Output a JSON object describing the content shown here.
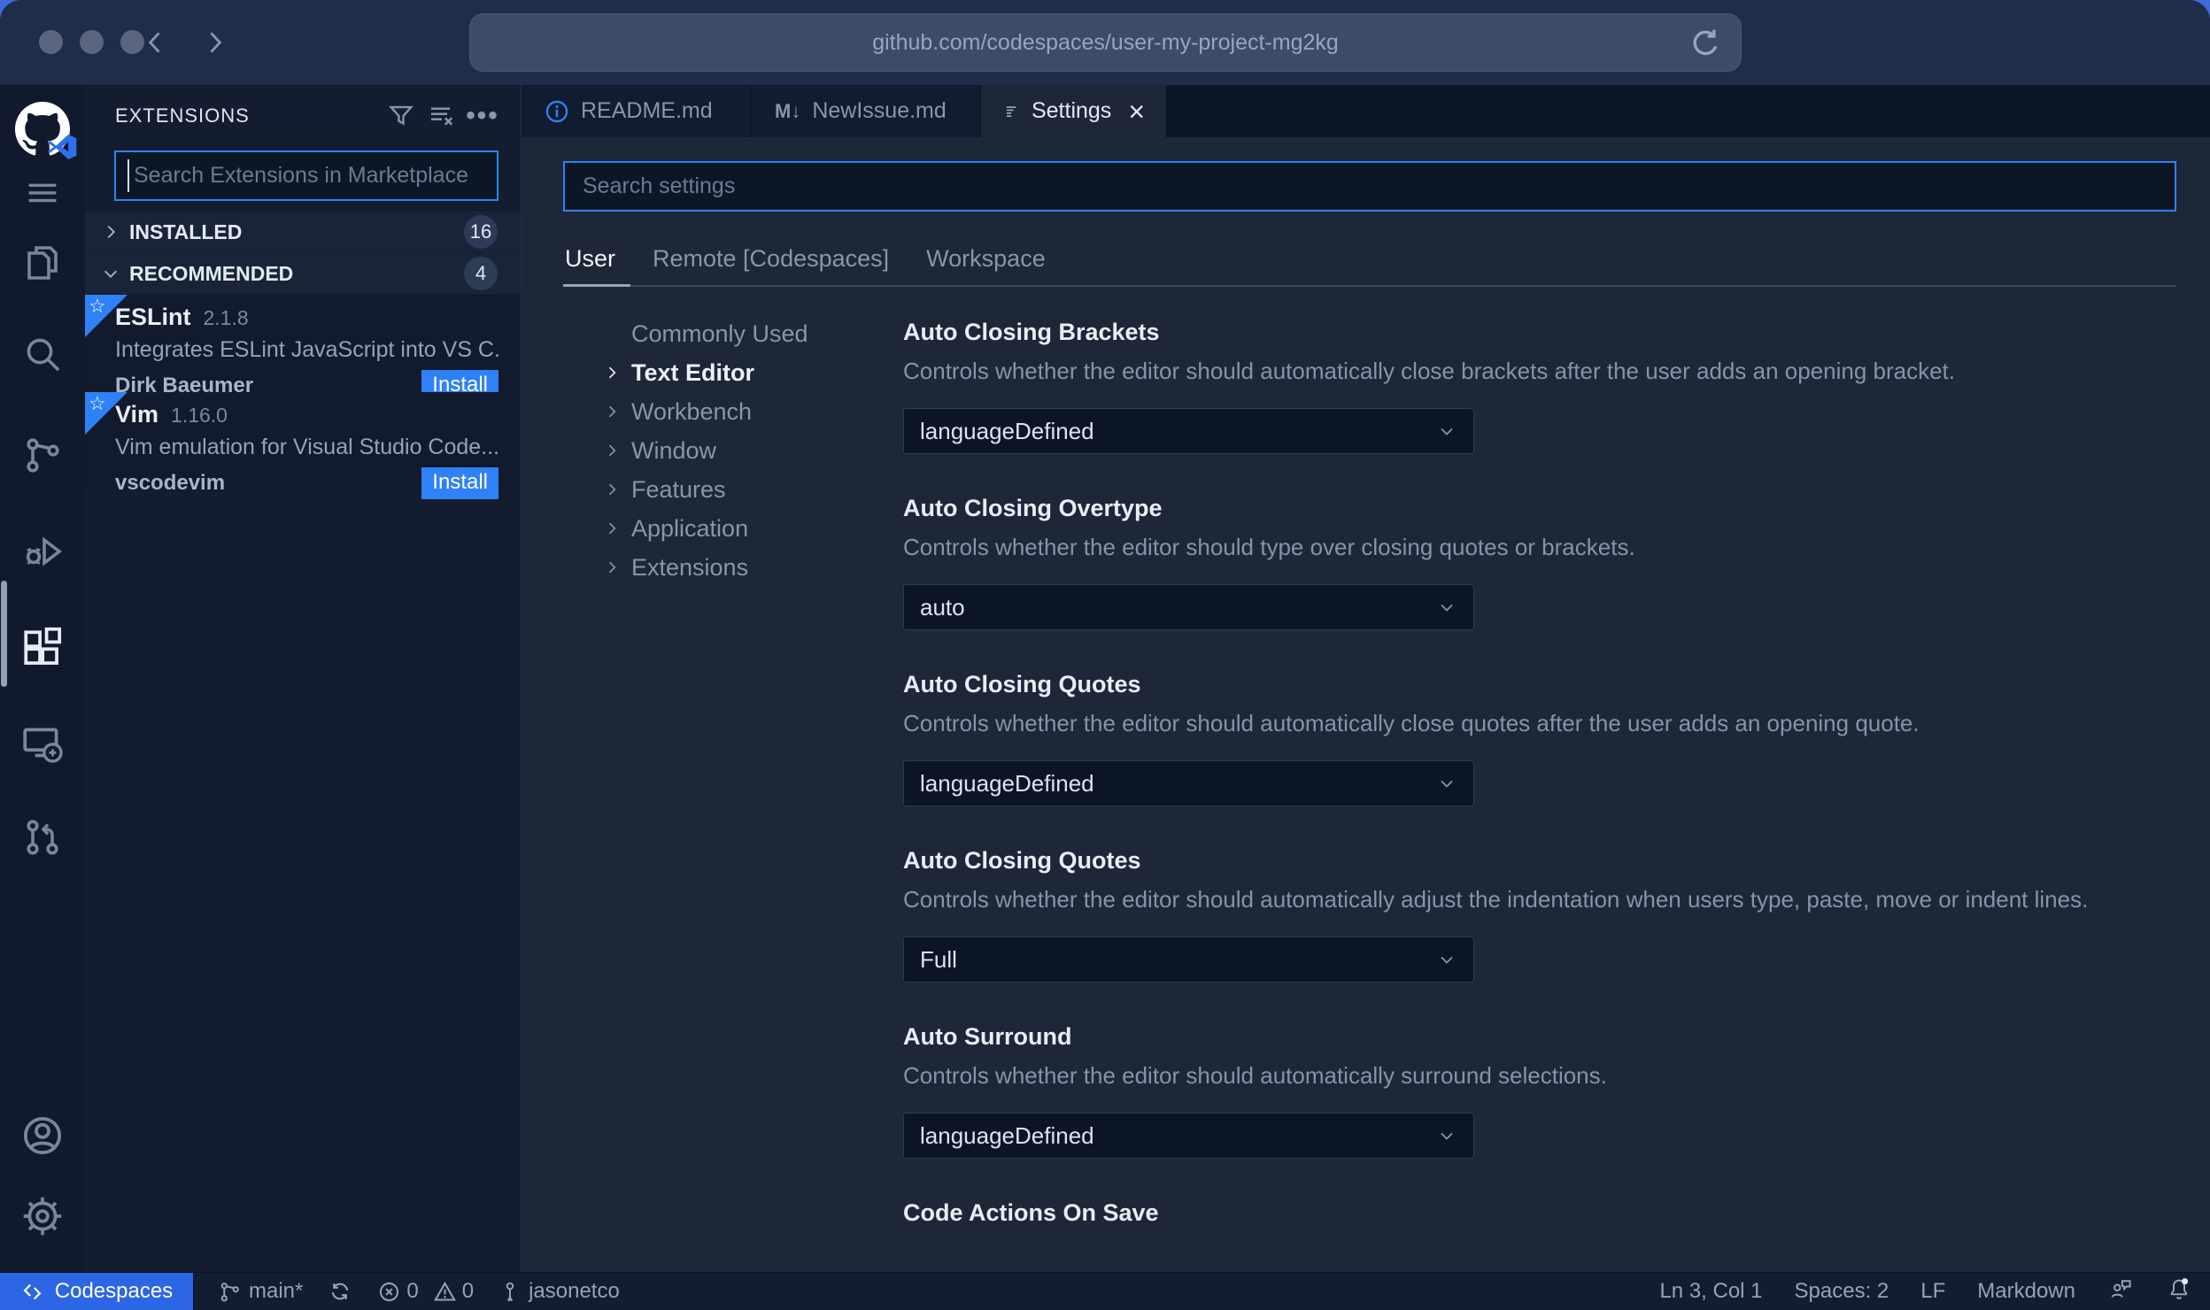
{
  "browser": {
    "url": "github.com/codespaces/user-my-project-mg2kg"
  },
  "icons": {
    "close": "×",
    "more": "•••",
    "markdown": "M↓",
    "star": "☆"
  },
  "colors": {
    "accent": "#2f81f7",
    "install_button": "#2f81f7",
    "codespaces_chip": "#2c66e4",
    "editor_bg": "#1d2737",
    "sidebar_bg": "#141d30",
    "statusbar_bg": "#121d31"
  },
  "extensions_panel": {
    "title": "EXTENSIONS",
    "search_placeholder": "Search Extensions in Marketplace",
    "sections": [
      {
        "label": "INSTALLED",
        "count": "16",
        "state": "collapsed"
      },
      {
        "label": "RECOMMENDED",
        "count": "4",
        "state": "expanded"
      }
    ],
    "items": [
      {
        "name": "ESLint",
        "version": "2.1.8",
        "description": "Integrates ESLint JavaScript into VS C...",
        "publisher": "Dirk Baeumer",
        "action": "Install"
      },
      {
        "name": "Vim",
        "version": "1.16.0",
        "description": "Vim emulation for Visual Studio Code...",
        "publisher": "vscodevim",
        "action": "Install"
      }
    ]
  },
  "tabs": [
    {
      "label": "README.md"
    },
    {
      "label": "NewIssue.md"
    },
    {
      "label": "Settings",
      "active": true
    }
  ],
  "settings_editor": {
    "search_placeholder": "Search settings",
    "scope_tabs": [
      {
        "label": "User",
        "active": true
      },
      {
        "label": "Remote [Codespaces]"
      },
      {
        "label": "Workspace"
      }
    ],
    "toc": [
      {
        "label": "Commonly Used"
      },
      {
        "label": "Text Editor",
        "active": true
      },
      {
        "label": "Workbench"
      },
      {
        "label": "Window"
      },
      {
        "label": "Features"
      },
      {
        "label": "Application"
      },
      {
        "label": "Extensions"
      }
    ],
    "settings": [
      {
        "title": "Auto Closing Brackets",
        "description": "Controls whether the editor should automatically close brackets after the user adds an opening bracket.",
        "value": "languageDefined"
      },
      {
        "title": "Auto Closing Overtype",
        "description": "Controls whether the editor should type over closing quotes or brackets.",
        "value": "auto"
      },
      {
        "title": "Auto Closing Quotes",
        "description": "Controls whether the editor should automatically close quotes after the user adds an opening quote.",
        "value": "languageDefined"
      },
      {
        "title": "Auto Closing Quotes",
        "description": "Controls whether the editor should automatically adjust the indentation when users type, paste, move or indent lines.",
        "value": "Full"
      },
      {
        "title": "Auto Surround",
        "description": "Controls whether the editor should automatically surround selections.",
        "value": "languageDefined"
      },
      {
        "title": "Code Actions On Save"
      }
    ]
  },
  "status_bar": {
    "remote_label": "Codespaces",
    "branch": "main*",
    "errors": "0",
    "warnings": "0",
    "user": "jasonetco",
    "cursor": "Ln 3, Col 1",
    "indent": "Spaces: 2",
    "eol": "LF",
    "language": "Markdown"
  }
}
